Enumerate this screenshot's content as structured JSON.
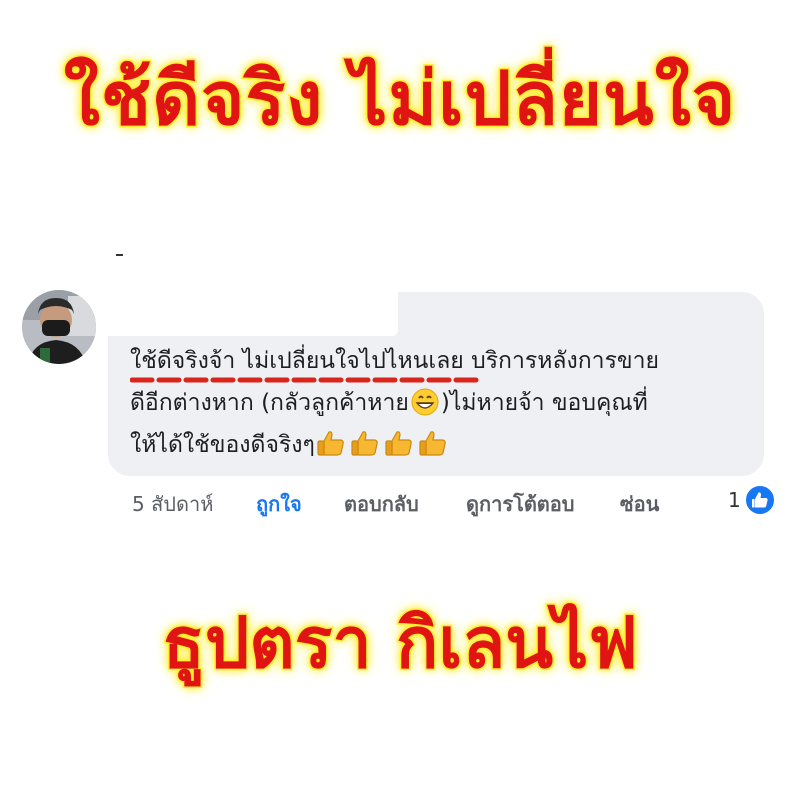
{
  "headline": "ใช้ดีจริง ไม่เปลี่ยนใจ",
  "comment": {
    "line1": "ใช้ดีจริงจ้า ไม่เปลี่ยนใจไปไหนเลย บริการหลังการขาย",
    "line2_pre": "ดีอีกต่างหาก (กลัวลูกค้าหาย",
    "line2_post": ")ไม่หายจ้า ขอบคุณที่",
    "line3": "ให้ได้ใช้ของดีจริงๆ",
    "emoji_icons": [
      "grinning-face-icon",
      "thumbs-up-icon"
    ]
  },
  "actions": {
    "time": "5 สัปดาห์",
    "like": "ถูกใจ",
    "reply": "ตอบกลับ",
    "view_replies": "ดูการโต้ตอบ",
    "hide": "ซ่อน",
    "reaction_count": "1"
  },
  "brand": "ธูปตรา กิเลนไฟ",
  "colors": {
    "headline_red": "#e11414",
    "headline_glow": "#ffee2a",
    "facebook_blue": "#1877f2",
    "bubble_bg": "#eef0f3",
    "underline_red": "#d9261c"
  }
}
